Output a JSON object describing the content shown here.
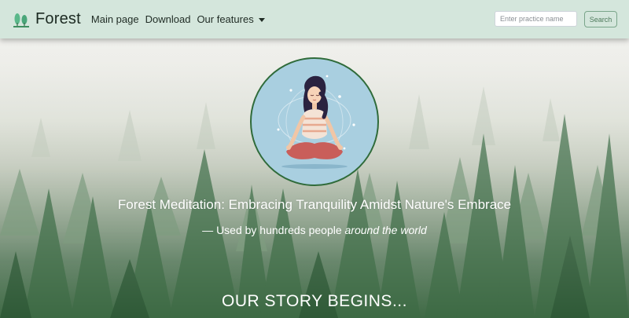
{
  "navbar": {
    "brand": "Forest",
    "links": [
      {
        "label": "Main page"
      },
      {
        "label": "Download"
      },
      {
        "label": "Our features"
      }
    ],
    "search": {
      "placeholder": "Enter practice name",
      "value": "",
      "button_label": "Search"
    },
    "bg_color": "#d4e6dc"
  },
  "hero": {
    "image_icon": "meditating-woman-illustration",
    "headline": "Forest Meditation: Embracing Tranquility Amidst Nature's Embrace",
    "tagline": {
      "dash": "—",
      "text": "Used by hundreds people",
      "emphasis": "around the world"
    },
    "section_heading": "OUR STORY BEGINS..."
  },
  "colors": {
    "accent": "#2f6b3a",
    "circle_bg": "#a9cfe0"
  }
}
